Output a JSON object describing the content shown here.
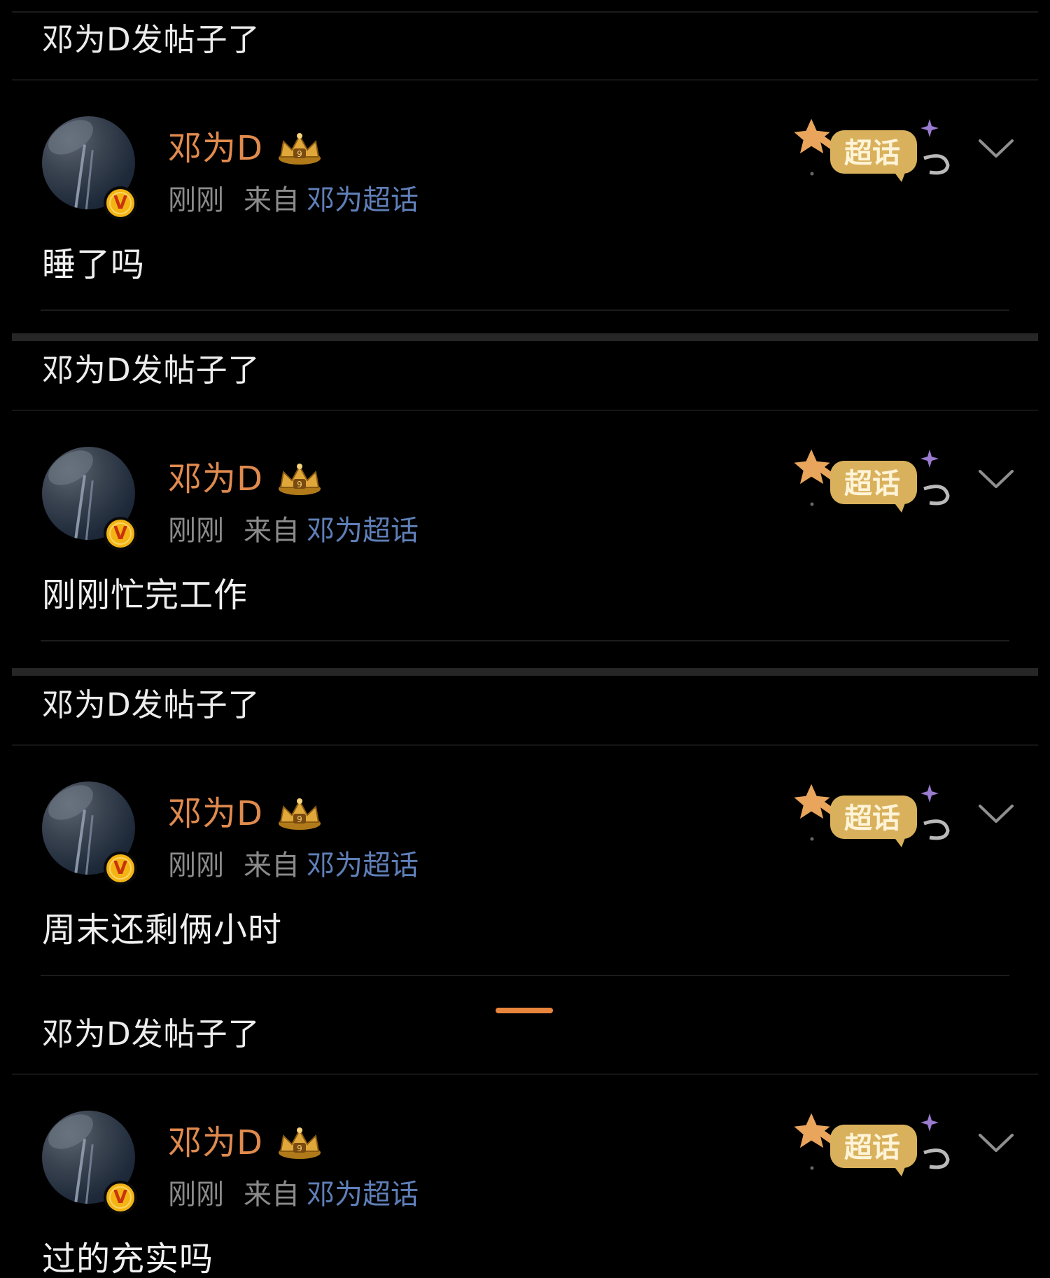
{
  "feed": {
    "posts": [
      {
        "header": "邓为D发帖子了",
        "author": "邓为D",
        "time": "刚刚",
        "from_label": "来自",
        "source": "邓为超话",
        "sticker_text": "超话",
        "text": "睡了吗"
      },
      {
        "header": "邓为D发帖子了",
        "author": "邓为D",
        "time": "刚刚",
        "from_label": "来自",
        "source": "邓为超话",
        "sticker_text": "超话",
        "text": "刚刚忙完工作"
      },
      {
        "header": "邓为D发帖子了",
        "author": "邓为D",
        "time": "刚刚",
        "from_label": "来自",
        "source": "邓为超话",
        "sticker_text": "超话",
        "text": "周末还剩俩小时"
      },
      {
        "header": "邓为D发帖子了",
        "author": "邓为D",
        "time": "刚刚",
        "from_label": "来自",
        "source": "邓为超话",
        "sticker_text": "超话",
        "text": "过的充实吗"
      }
    ]
  },
  "colors": {
    "background": "#000000",
    "username": "#e08a4e",
    "source_link": "#5f7fb8",
    "meta": "#8b8b8b",
    "accent_indicator": "#e8853d"
  },
  "icons": {
    "verified_badge": "v-badge-icon",
    "level_badge": "crown-icon",
    "sticker": "super-topic-sticker-icon",
    "menu": "chevron-down-icon"
  },
  "badges": {
    "verified_letter": "V",
    "crown_level": "9"
  }
}
